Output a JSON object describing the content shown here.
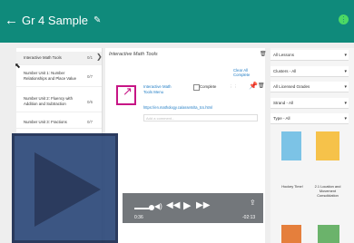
{
  "header": {
    "back_glyph": "←",
    "title": "Gr 4 Sample",
    "edit_glyph": "✎",
    "menu_dot": "⋮"
  },
  "sidebar": {
    "items": [
      {
        "name": "Interactive Math Tools",
        "count": "0/1",
        "active": true,
        "chevron": "❯"
      },
      {
        "name": "Number Unit 1: Number Relationships and Place Value",
        "count": "0/7"
      },
      {
        "name": "Number Unit 2: Fluency with Addition and Subtraction",
        "count": "0/6"
      },
      {
        "name": "Number Unit 3: Fractions",
        "count": "0/7"
      }
    ],
    "cursor_glyph": "⬉"
  },
  "main": {
    "section_title": "Interactive Math Tools",
    "clear_all": "Clear All Complete",
    "resource": {
      "title": "Interactive Math Tools Menu",
      "complete_label": "Complete",
      "url": "https://en.mathology.ca/assets/ta_tcs.html",
      "comment_placeholder": "Add a comment..."
    },
    "trash_glyph": "🗑",
    "pin_glyph": "📌"
  },
  "filters": {
    "options": [
      "All Lessons",
      "Clusters - All",
      "All Licensed Grades",
      "Strand - All",
      "Type - All"
    ],
    "caret": "▾"
  },
  "books": [
    {
      "title": "Hockey Time!",
      "color": "#7cc3e6"
    },
    {
      "title": "2.1 Location and Movement Consolidation",
      "color": "#f6c24a"
    },
    {
      "title": "",
      "color": "#e57f3c"
    },
    {
      "title": "",
      "color": "#6bb36b"
    }
  ],
  "player": {
    "current_time": "0:36",
    "remaining_time": "-02:13",
    "volume_glyph": "◀)",
    "rewind_glyph": "◀◀",
    "play_glyph": "▶",
    "forward_glyph": "▶▶",
    "share_glyph": "⇪"
  }
}
